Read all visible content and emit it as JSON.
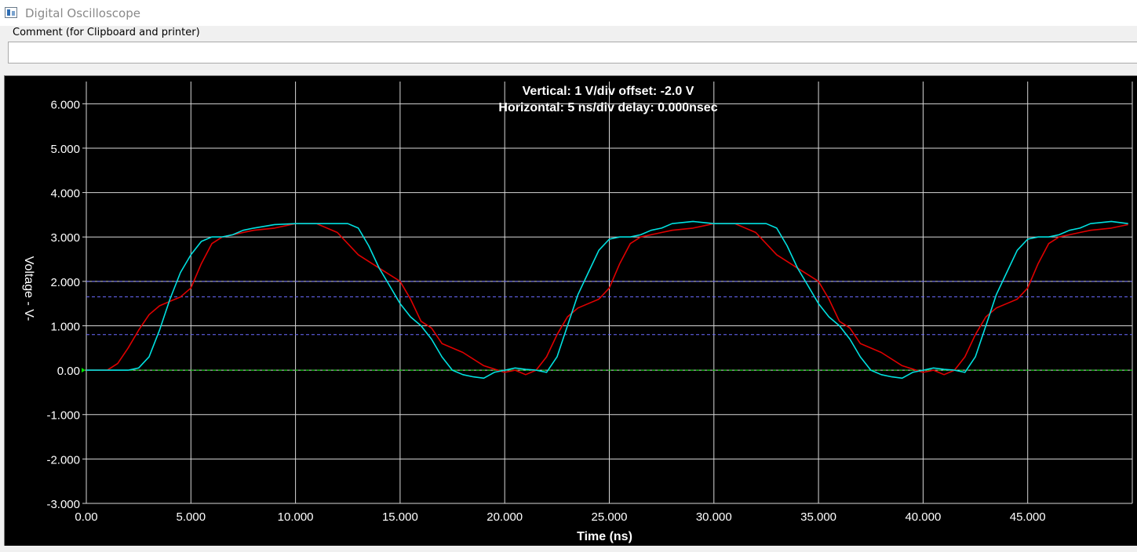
{
  "window": {
    "title": "Digital Oscilloscope",
    "icon": "oscilloscope-app-icon"
  },
  "comment": {
    "label": "Comment (for Clipboard and printer)",
    "value": "",
    "placeholder": ""
  },
  "chart_data": {
    "type": "line",
    "title_lines": [
      "Vertical: 1  V/div  offset: -2.0 V",
      "Horizontal: 5 ns/div  delay: 0.000nsec"
    ],
    "xlabel": "Time  (ns)",
    "ylabel": "Voltage  - V-",
    "xlim": [
      0,
      50
    ],
    "ylim": [
      -3,
      6.5
    ],
    "x_ticks": [
      0,
      5,
      10,
      15,
      20,
      25,
      30,
      35,
      40,
      45
    ],
    "x_tick_labels": [
      "0.00",
      "5.000",
      "10.000",
      "15.000",
      "20.000",
      "25.000",
      "30.000",
      "35.000",
      "40.000",
      "45.000"
    ],
    "y_ticks": [
      6,
      5,
      4,
      3,
      2,
      1,
      0,
      -1,
      -2,
      -3
    ],
    "y_tick_labels": [
      "6.000",
      "5.000",
      "4.000",
      "3.000",
      "2.000",
      "1.000",
      "0.00",
      "-1.000",
      "-2.000",
      "-3.000"
    ],
    "grid": true,
    "background": "#000000",
    "grid_color": "#d8d8d8",
    "text_color": "#ffffff",
    "reference_lines": [
      {
        "y": 2.0,
        "color": "#6b6bff",
        "style": "dashed"
      },
      {
        "y": 1.65,
        "color": "#6b6bff",
        "style": "dashed"
      },
      {
        "y": 0.8,
        "color": "#6b6bff",
        "style": "dashed"
      },
      {
        "y": 0.0,
        "color": "#00e000",
        "style": "dashed"
      }
    ],
    "series": [
      {
        "color": "#e00000",
        "x": [
          0,
          1.0,
          1.5,
          2.0,
          2.5,
          3.0,
          3.5,
          4.0,
          4.5,
          5.0,
          5.5,
          6.0,
          6.5,
          7.0,
          7.5,
          8.0,
          9.0,
          10.0,
          11.0,
          12.0,
          13.0,
          14.0,
          15.0,
          15.5,
          16.0,
          16.5,
          17.0,
          18.0,
          19.0,
          20.0,
          20.5,
          21.0,
          21.5,
          22.0,
          22.5,
          23.0,
          23.5,
          24.0,
          24.5,
          25.0,
          25.5,
          26.0,
          26.5,
          27.0,
          27.5,
          28.0,
          29.0,
          30.0,
          31.0,
          32.0,
          33.0,
          34.0,
          35.0,
          35.5,
          36.0,
          36.5,
          37.0,
          38.0,
          39.0,
          40.0,
          40.5,
          41.0,
          41.5,
          42.0,
          42.5,
          43.0,
          43.5,
          44.0,
          44.5,
          45.0,
          45.5,
          46.0,
          46.5,
          47.0,
          47.5,
          48.0,
          49.0,
          49.8
        ],
        "y": [
          0,
          0.0,
          0.15,
          0.5,
          0.9,
          1.25,
          1.45,
          1.55,
          1.65,
          1.85,
          2.4,
          2.85,
          3.0,
          3.05,
          3.1,
          3.15,
          3.2,
          3.3,
          3.3,
          3.1,
          2.6,
          2.3,
          2.0,
          1.6,
          1.1,
          0.95,
          0.6,
          0.4,
          0.1,
          -0.05,
          0.0,
          -0.1,
          0.0,
          0.3,
          0.8,
          1.2,
          1.4,
          1.5,
          1.6,
          1.85,
          2.4,
          2.85,
          3.0,
          3.05,
          3.1,
          3.15,
          3.2,
          3.3,
          3.3,
          3.1,
          2.6,
          2.3,
          2.0,
          1.6,
          1.1,
          0.95,
          0.6,
          0.4,
          0.1,
          -0.05,
          0.0,
          -0.1,
          0.0,
          0.3,
          0.8,
          1.2,
          1.4,
          1.5,
          1.6,
          1.85,
          2.4,
          2.85,
          3.0,
          3.05,
          3.1,
          3.15,
          3.2,
          3.28
        ]
      },
      {
        "color": "#00e0e0",
        "x": [
          0,
          2.0,
          2.5,
          3.0,
          3.5,
          4.0,
          4.5,
          5.0,
          5.5,
          6.0,
          6.5,
          7.0,
          7.5,
          8.0,
          9.0,
          10.0,
          11.0,
          12.0,
          12.5,
          13.0,
          13.5,
          14.0,
          14.5,
          15.0,
          15.5,
          16.0,
          16.5,
          17.0,
          17.5,
          18.0,
          18.5,
          19.0,
          19.5,
          20.0,
          20.5,
          21.0,
          21.5,
          22.0,
          22.5,
          23.0,
          23.5,
          24.0,
          24.5,
          25.0,
          25.5,
          26.0,
          26.5,
          27.0,
          27.5,
          28.0,
          29.0,
          30.0,
          31.0,
          32.0,
          32.5,
          33.0,
          33.5,
          34.0,
          34.5,
          35.0,
          35.5,
          36.0,
          36.5,
          37.0,
          37.5,
          38.0,
          38.5,
          39.0,
          39.5,
          40.0,
          40.5,
          41.0,
          41.5,
          42.0,
          42.5,
          43.0,
          43.5,
          44.0,
          44.5,
          45.0,
          45.5,
          46.0,
          46.5,
          47.0,
          47.5,
          48.0,
          49.0,
          49.8
        ],
        "y": [
          0,
          0.0,
          0.05,
          0.3,
          0.9,
          1.6,
          2.2,
          2.6,
          2.9,
          3.0,
          3.0,
          3.05,
          3.15,
          3.2,
          3.28,
          3.3,
          3.3,
          3.3,
          3.3,
          3.2,
          2.8,
          2.3,
          1.9,
          1.5,
          1.2,
          1.0,
          0.7,
          0.3,
          0.0,
          -0.1,
          -0.15,
          -0.18,
          -0.05,
          0.0,
          0.05,
          0.02,
          0.0,
          -0.05,
          0.3,
          1.0,
          1.7,
          2.2,
          2.7,
          2.95,
          3.0,
          3.0,
          3.05,
          3.15,
          3.2,
          3.3,
          3.35,
          3.3,
          3.3,
          3.3,
          3.3,
          3.2,
          2.8,
          2.3,
          1.9,
          1.5,
          1.2,
          1.0,
          0.7,
          0.3,
          0.0,
          -0.1,
          -0.15,
          -0.18,
          -0.05,
          0.0,
          0.05,
          0.02,
          0.0,
          -0.05,
          0.3,
          1.0,
          1.7,
          2.2,
          2.7,
          2.95,
          3.0,
          3.0,
          3.05,
          3.15,
          3.2,
          3.3,
          3.35,
          3.3
        ]
      }
    ]
  }
}
